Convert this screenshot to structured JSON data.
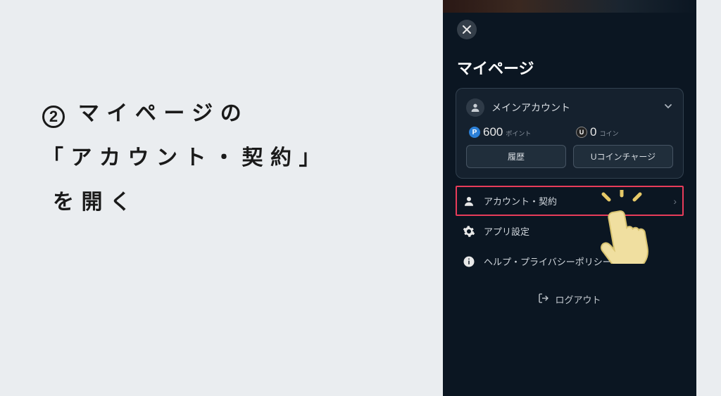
{
  "instruction": {
    "step_number": "2",
    "line1_prefix": "マイページの",
    "line2": "「アカウント・契約」",
    "line3": "を開く"
  },
  "mypage": {
    "title": "マイページ",
    "account": {
      "name": "メインアカウント"
    },
    "points": {
      "badge": "P",
      "value": "600",
      "unit": "ポイント",
      "button": "履歴"
    },
    "coins": {
      "badge": "U",
      "value": "0",
      "unit": "コイン",
      "button": "Uコインチャージ"
    },
    "menu": {
      "account_contract": "アカウント・契約",
      "app_settings": "アプリ設定",
      "help_privacy": "ヘルプ・プライバシーポリシー"
    },
    "logout": "ログアウト"
  }
}
